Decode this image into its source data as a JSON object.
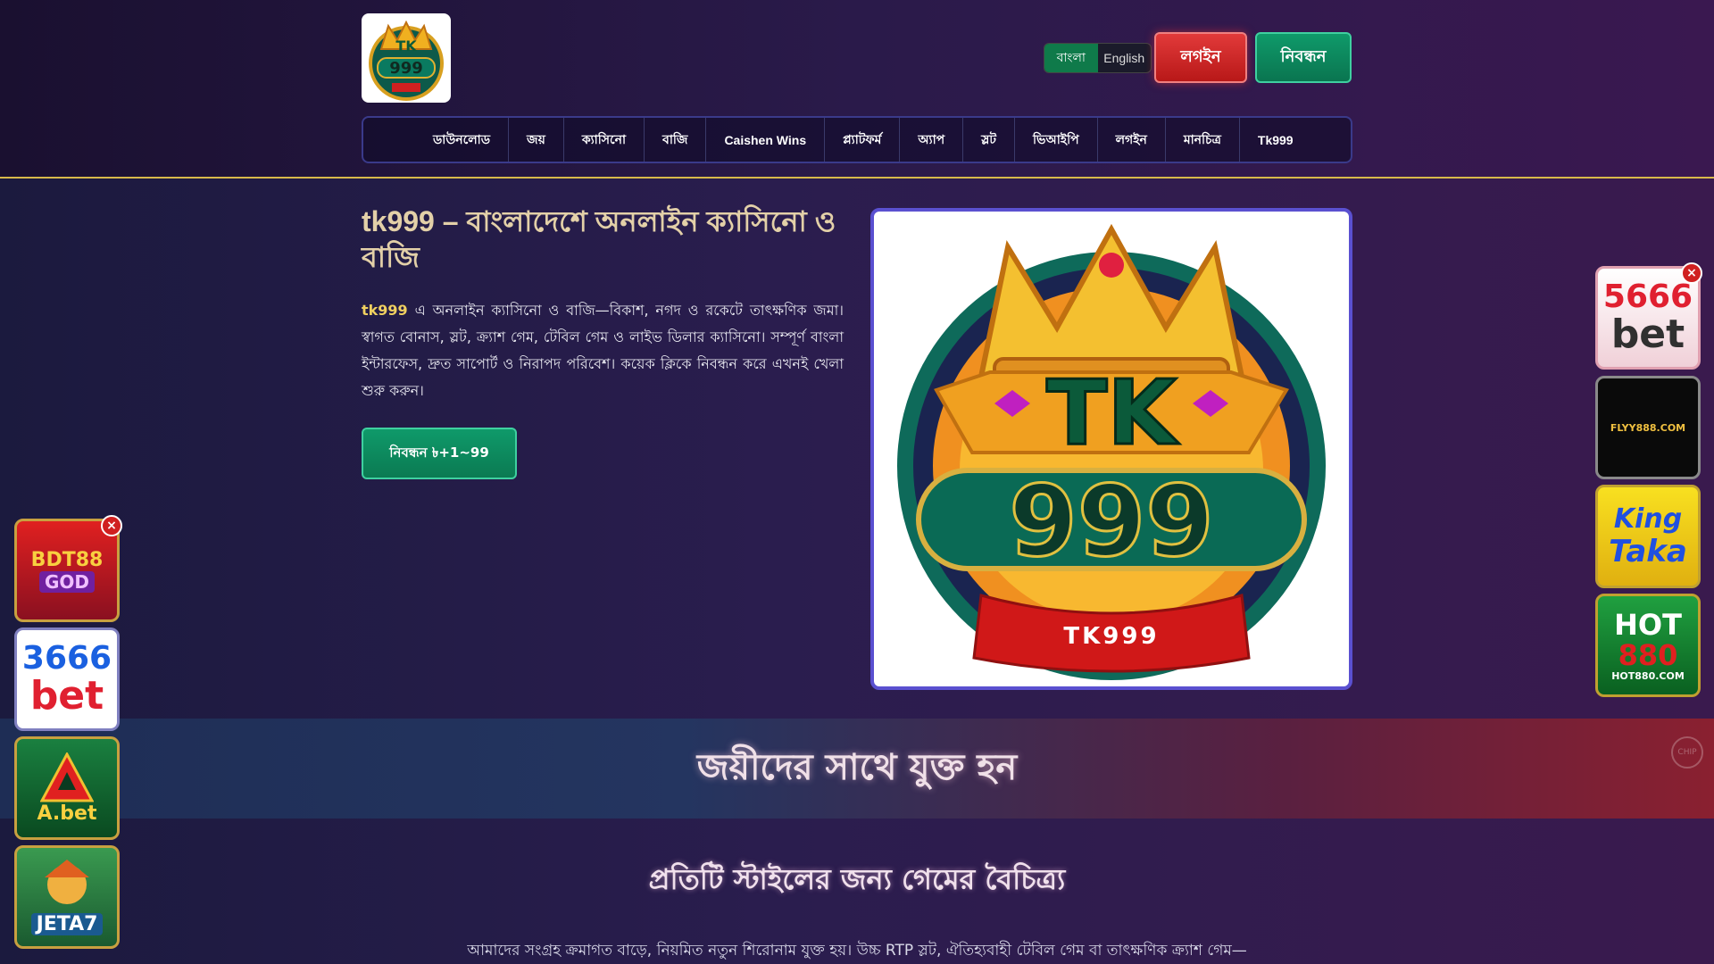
{
  "header": {
    "logo_alt": "TK999",
    "languages": [
      "বাংলা",
      "English"
    ],
    "login_label": "লগইন",
    "register_label": "নিবন্ধন"
  },
  "nav": {
    "items": [
      "ডাউনলোড",
      "জয়",
      "ক্যাসিনো",
      "বাজি",
      "Caishen Wins",
      "প্ল্যাটফর্ম",
      "অ্যাপ",
      "স্লট",
      "ভিআইপি",
      "লগইন",
      "মানচিত্র",
      "Tk999"
    ]
  },
  "hero": {
    "title": "tk999 – বাংলাদেশে অনলাইন ক্যাসিনো ও বাজি",
    "brand": "tk999",
    "text": " এ অনলাইন ক্যাসিনো ও বাজি—বিকাশ, নগদ ও রকেটে তাৎক্ষণিক জমা। স্বাগত বোনাস, স্লট, ক্র্যাশ গেম, টেবিল গেম ও লাইভ ডিলার ক্যাসিনো। সম্পূর্ণ বাংলা ইন্টারফেস, দ্রুত সাপোর্ট ও নিরাপদ পরিবেশ। কয়েক ক্লিকে নিবন্ধন করে এখনই খেলা শুরু করুন।",
    "cta_label": "নিবন্ধন ৳+1~99",
    "image_label_top": "TK",
    "image_label_num": "999",
    "image_ribbon": "TK999"
  },
  "banner": {
    "title": "জয়ীদের সাথে যুক্ত হন",
    "chip_label": "CHIP"
  },
  "variety": {
    "title": "প্রতিটি স্টাইলের জন্য গেমের বৈচিত্র্য",
    "text": "আমাদের সংগ্রহ ক্রমাগত বাড়ে, নিয়মিত নতুন শিরোনাম যুক্ত হয়। উচ্চ RTP স্লট, ঐতিহ্যবাহী টেবিল গেম বা তাৎক্ষণিক ক্র্যাশ গেম—"
  },
  "ads_left": [
    {
      "line1": "BDT88",
      "line2": "GOD"
    },
    {
      "line1": "3666",
      "line2": "bet"
    },
    {
      "line1": "A.bet",
      "line2": ""
    },
    {
      "line1": "JETA7",
      "line2": ""
    }
  ],
  "ads_right": [
    {
      "line1": "5666",
      "line2": "bet"
    },
    {
      "line1": "FLYY888.COM",
      "line2": ""
    },
    {
      "line1": "King",
      "line2": "Taka"
    },
    {
      "line1": "HOT",
      "line2": "880",
      "line3": "HOT880.COM"
    }
  ],
  "close_symbol": "×",
  "colors": {
    "accent_gold": "#d8b94a",
    "login_red": "#d02828",
    "register_green": "#0f8a5e",
    "title_beige": "#e3d0a8"
  }
}
